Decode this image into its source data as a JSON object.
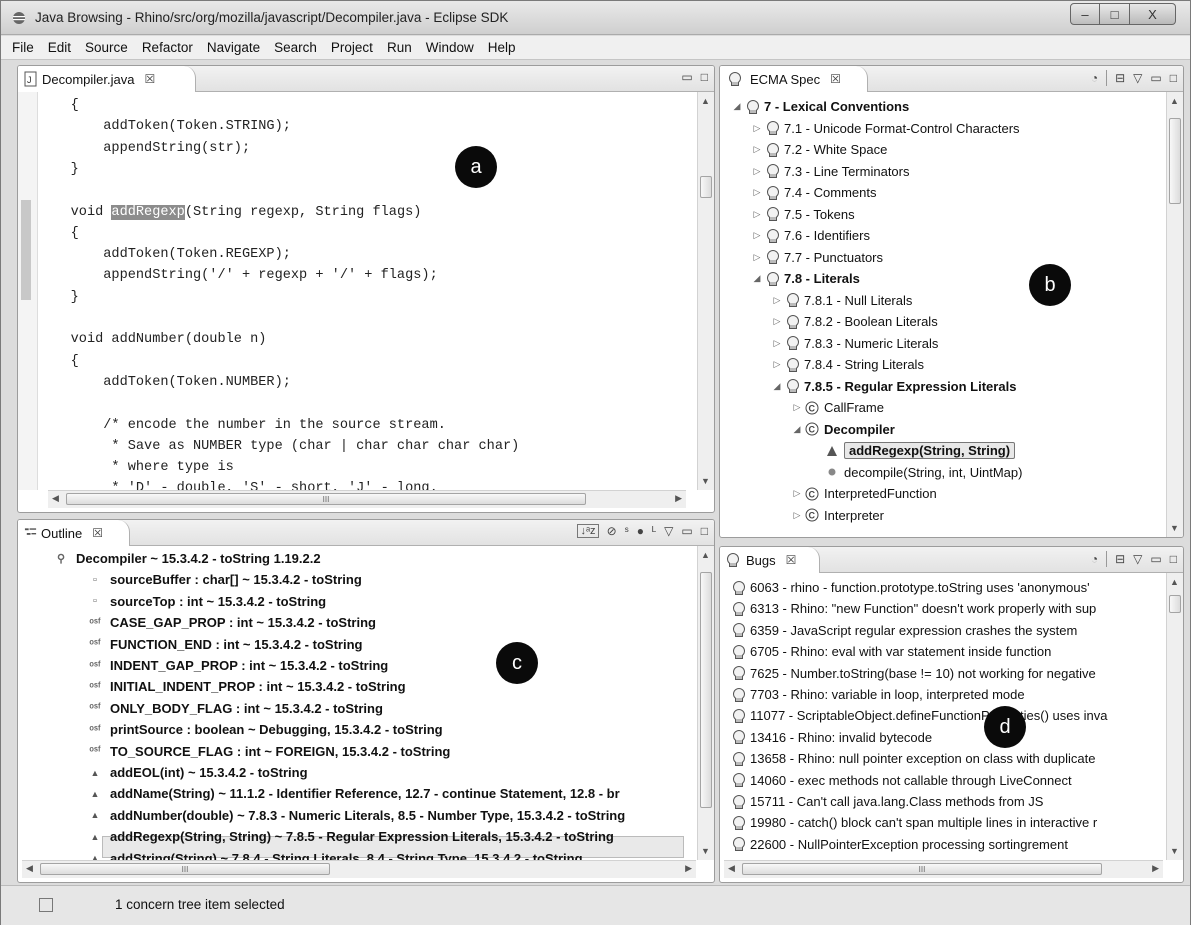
{
  "window": {
    "title": "Java Browsing - Rhino/src/org/mozilla/javascript/Decompiler.java - Eclipse SDK",
    "controls": [
      "–",
      "□",
      "X"
    ]
  },
  "menu": [
    "File",
    "Edit",
    "Source",
    "Refactor",
    "Navigate",
    "Search",
    "Project",
    "Run",
    "Window",
    "Help"
  ],
  "editor": {
    "tab_label": "Decompiler.java",
    "tab_close": "☒",
    "code_lines": [
      {
        "text": "    {"
      },
      {
        "text": "        addToken(Token.STRING);"
      },
      {
        "text": "        appendString(str);"
      },
      {
        "text": "    }"
      },
      {
        "text": ""
      },
      {
        "text": "    void addRegexp(String regexp, String flags)"
      },
      {
        "text": "    {"
      },
      {
        "text": "        addToken(Token.REGEXP);"
      },
      {
        "text": "        appendString('/' + regexp + '/' + flags);"
      },
      {
        "text": "    }"
      },
      {
        "text": ""
      },
      {
        "text": "    void addNumber(double n)"
      },
      {
        "text": "    {"
      },
      {
        "text": "        addToken(Token.NUMBER);"
      },
      {
        "text": ""
      },
      {
        "text": "        /* encode the number in the source stream."
      },
      {
        "text": "         * Save as NUMBER type (char | char char char char)"
      },
      {
        "text": "         * where type is"
      },
      {
        "text": "         * 'D' - double, 'S' - short, 'J' - long."
      }
    ],
    "highlight_word": "addRegexp",
    "hscroll_grip": "III"
  },
  "ecma": {
    "tab_label": "ECMA Spec",
    "tab_close": "☒",
    "items": [
      {
        "label": "7 - Lexical Conventions",
        "level": 0,
        "bold": true,
        "twisty": "open",
        "icon": "concern-group"
      },
      {
        "label": "7.1 - Unicode Format-Control Characters",
        "level": 1,
        "twisty": "closed",
        "icon": "bulb"
      },
      {
        "label": "7.2 - White Space",
        "level": 1,
        "twisty": "closed",
        "icon": "bulb"
      },
      {
        "label": "7.3 - Line Terminators",
        "level": 1,
        "twisty": "closed",
        "icon": "bulb"
      },
      {
        "label": "7.4 - Comments",
        "level": 1,
        "twisty": "closed",
        "icon": "bulb"
      },
      {
        "label": "7.5 - Tokens",
        "level": 1,
        "twisty": "closed",
        "icon": "concern-group"
      },
      {
        "label": "7.6 - Identifiers",
        "level": 1,
        "twisty": "closed",
        "icon": "bulb"
      },
      {
        "label": "7.7 - Punctuators",
        "level": 1,
        "twisty": "closed",
        "icon": "bulb"
      },
      {
        "label": "7.8 - Literals",
        "level": 1,
        "bold": true,
        "twisty": "open",
        "icon": "concern-group"
      },
      {
        "label": "7.8.1 - Null Literals",
        "level": 2,
        "twisty": "closed",
        "icon": "bulb"
      },
      {
        "label": "7.8.2 - Boolean Literals",
        "level": 2,
        "twisty": "closed",
        "icon": "bulb"
      },
      {
        "label": "7.8.3 - Numeric Literals",
        "level": 2,
        "twisty": "closed",
        "icon": "bulb"
      },
      {
        "label": "7.8.4 - String Literals",
        "level": 2,
        "twisty": "closed",
        "icon": "bulb"
      },
      {
        "label": "7.8.5 - Regular Expression Literals",
        "level": 2,
        "bold": true,
        "twisty": "open",
        "icon": "bulb"
      },
      {
        "label": "CallFrame",
        "level": 3,
        "twisty": "closed",
        "icon": "class-c"
      },
      {
        "label": "Decompiler",
        "level": 3,
        "bold": true,
        "twisty": "open",
        "icon": "class-c"
      },
      {
        "label": "addRegexp(String, String)",
        "level": 4,
        "bold": true,
        "twisty": "none",
        "icon": "method-triangle",
        "selected": true
      },
      {
        "label": "decompile(String, int, UintMap)",
        "level": 4,
        "twisty": "none",
        "icon": "method-dot"
      },
      {
        "label": "InterpretedFunction",
        "level": 3,
        "twisty": "closed",
        "icon": "class-c"
      },
      {
        "label": "Interpreter",
        "level": 3,
        "twisty": "closed",
        "icon": "class-c"
      }
    ]
  },
  "outline": {
    "tab_label": "Outline",
    "tab_close": "☒",
    "items": [
      {
        "label": "Decompiler ~ 15.3.4.2 - toString  1.19.2.2",
        "icon": "package-class",
        "indent": 0
      },
      {
        "label": "sourceBuffer : char[] ~ 15.3.4.2 - toString",
        "icon": "field",
        "indent": 1
      },
      {
        "label": "sourceTop : int ~ 15.3.4.2 - toString",
        "icon": "field",
        "indent": 1
      },
      {
        "label": "CASE_GAP_PROP : int ~ 15.3.4.2 - toString",
        "icon": "static-field",
        "indent": 1
      },
      {
        "label": "FUNCTION_END : int ~ 15.3.4.2 - toString",
        "icon": "static-field",
        "indent": 1
      },
      {
        "label": "INDENT_GAP_PROP : int ~ 15.3.4.2 - toString",
        "icon": "static-field",
        "indent": 1
      },
      {
        "label": "INITIAL_INDENT_PROP : int ~ 15.3.4.2 - toString",
        "icon": "static-field",
        "indent": 1
      },
      {
        "label": "ONLY_BODY_FLAG : int ~ 15.3.4.2 - toString",
        "icon": "static-field",
        "indent": 1
      },
      {
        "label": "printSource : boolean ~ Debugging, 15.3.4.2 - toString",
        "icon": "static-field",
        "indent": 1
      },
      {
        "label": "TO_SOURCE_FLAG : int ~ FOREIGN, 15.3.4.2 - toString",
        "icon": "static-field",
        "indent": 1
      },
      {
        "label": "addEOL(int) ~ 15.3.4.2 - toString",
        "icon": "method",
        "indent": 1
      },
      {
        "label": "addName(String) ~ 11.1.2 - Identifier Reference, 12.7 - continue Statement, 12.8 - br",
        "icon": "method",
        "indent": 1
      },
      {
        "label": "addNumber(double) ~ 7.8.3 - Numeric Literals, 8.5 - Number Type, 15.3.4.2 - toString",
        "icon": "method",
        "indent": 1
      },
      {
        "label": "addRegexp(String, String) ~ 7.8.5 - Regular Expression Literals, 15.3.4.2 - toString",
        "icon": "method",
        "indent": 1,
        "selected": true
      },
      {
        "label": "addString(String) ~ 7.8.4 - String Literals, 8.4 - String Type, 15.3.4.2 - toString",
        "icon": "method",
        "indent": 1
      }
    ]
  },
  "bugs": {
    "tab_label": "Bugs",
    "tab_close": "☒",
    "items": [
      "6063 - rhino - function.prototype.toString uses 'anonymous'",
      "6313 - Rhino: \"new Function\" doesn't work properly with sup",
      "6359 - JavaScript regular expression crashes the system",
      "6705 - Rhino: eval with var statement inside function",
      "7625 - Number.toString(base != 10) not working for negative",
      "7703 - Rhino: variable in loop, interpreted mode",
      "11077 - ScriptableObject.defineFunctionProperties() uses inva",
      "13416 - Rhino: invalid bytecode",
      "13658 - Rhino: null pointer exception on class with duplicate",
      "14060 - exec methods not callable through LiveConnect",
      "15711 - Can't call java.lang.Class methods from JS",
      "19980 - catch() block can't span multiple lines in interactive r",
      "22600 - NullPointerException processing sortingrement"
    ]
  },
  "markers": {
    "a": "a",
    "b": "b",
    "c": "c",
    "d": "d"
  },
  "status": {
    "text": "1 concern tree item selected"
  }
}
